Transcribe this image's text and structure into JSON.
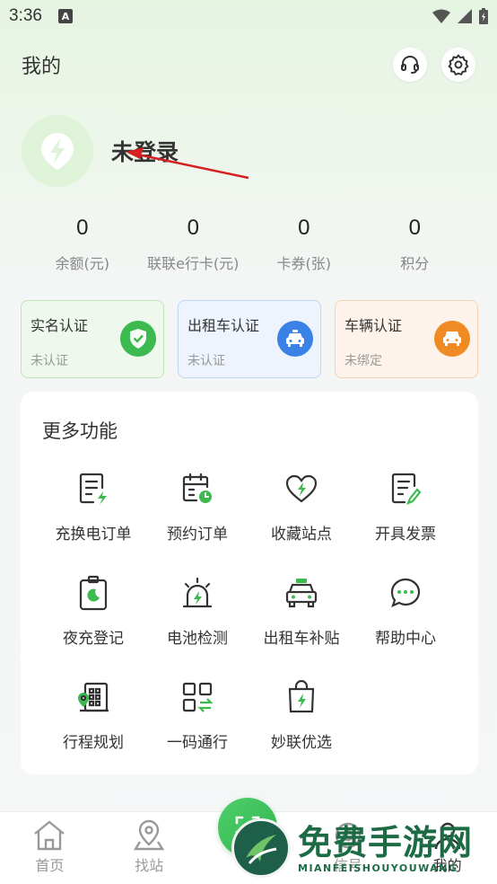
{
  "status": {
    "time": "3:36",
    "app_icon_letter": "A"
  },
  "header": {
    "title": "我的"
  },
  "profile": {
    "login_status": "未登录"
  },
  "stats": [
    {
      "value": "0",
      "label": "余额(元)"
    },
    {
      "value": "0",
      "label": "联联e行卡(元)"
    },
    {
      "value": "0",
      "label": "卡券(张)"
    },
    {
      "value": "0",
      "label": "积分"
    }
  ],
  "certifications": [
    {
      "title": "实名认证",
      "status": "未认证",
      "icon": "shield-check-icon",
      "color": "#3cb94f"
    },
    {
      "title": "出租车认证",
      "status": "未认证",
      "icon": "taxi-icon",
      "color": "#3b82e6"
    },
    {
      "title": "车辆认证",
      "status": "未绑定",
      "icon": "car-icon",
      "color": "#f08a24"
    }
  ],
  "more_functions": {
    "title": "更多功能",
    "items": [
      {
        "label": "充换电订单",
        "icon": "charge-order-icon"
      },
      {
        "label": "预约订单",
        "icon": "reservation-icon"
      },
      {
        "label": "收藏站点",
        "icon": "favorite-station-icon"
      },
      {
        "label": "开具发票",
        "icon": "invoice-icon"
      },
      {
        "label": "夜充登记",
        "icon": "night-charge-icon"
      },
      {
        "label": "电池检测",
        "icon": "battery-check-icon"
      },
      {
        "label": "出租车补贴",
        "icon": "taxi-subsidy-icon"
      },
      {
        "label": "帮助中心",
        "icon": "help-chat-icon"
      },
      {
        "label": "行程规划",
        "icon": "trip-plan-icon"
      },
      {
        "label": "一码通行",
        "icon": "qr-pass-icon"
      },
      {
        "label": "妙联优选",
        "icon": "shopping-bag-icon"
      }
    ]
  },
  "bottom_nav": [
    {
      "label": "首页",
      "icon": "home-icon"
    },
    {
      "label": "找站",
      "icon": "location-icon"
    },
    {
      "label": "",
      "icon": "scan-icon"
    },
    {
      "label": "信号",
      "icon": "signal-icon"
    },
    {
      "label": "我的",
      "icon": "profile-icon"
    }
  ],
  "watermark": {
    "main": "免费手游网",
    "sub": "MIANFEISHOUYOUWANG"
  },
  "colors": {
    "accent": "#3cb94f",
    "annotation_arrow": "#d42020"
  }
}
